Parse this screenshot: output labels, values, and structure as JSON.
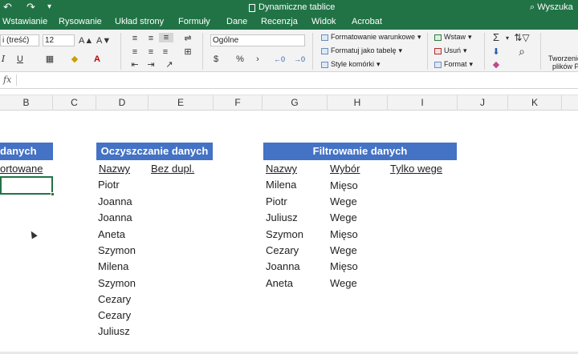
{
  "title_bar": {
    "undo_icon": "undo-icon",
    "redo_icon": "redo-icon",
    "customize_icon": "customize-qat-icon",
    "document_title": "Dynamiczne tablice",
    "search_label": "Wyszuka"
  },
  "menu": {
    "items": [
      "Wstawianie",
      "Rysowanie",
      "Układ strony",
      "Formuły",
      "Dane",
      "Recenzja",
      "Widok",
      "Acrobat"
    ]
  },
  "ribbon": {
    "font_name": "i (treść)",
    "font_size": "12",
    "grow_font": "A▲",
    "shrink_font": "A▼",
    "italic": "I",
    "underline": "U",
    "number_format": "Ogólne",
    "currency": "$",
    "percent": "%",
    "comma": "›",
    "conditional_formatting": "Formatowanie warunkowe",
    "format_as_table": "Formatuj jako tabelę",
    "cell_styles": "Style komórki",
    "insert": "Wstaw",
    "delete": "Usuń",
    "format": "Format",
    "sum": "Σ",
    "create_pdf_line1": "Tworzenie",
    "create_pdf_line2": "plików P"
  },
  "formula_bar": {
    "fx": "fx"
  },
  "columns": [
    "B",
    "C",
    "D",
    "E",
    "F",
    "G",
    "H",
    "I",
    "J",
    "K"
  ],
  "sheet": {
    "left_header": "danych",
    "left_subheader": "ortowane",
    "cleaning": {
      "header": "Oczyszczanie danych",
      "col_names": "Nazwy",
      "col_unique": "Bez dupl.",
      "names": [
        "Piotr",
        "Joanna",
        "Joanna",
        "Aneta",
        "Szymon",
        "Milena",
        "Szymon",
        "Cezary",
        "Cezary",
        "Juliusz"
      ]
    },
    "filtering": {
      "header": "Filtrowanie danych",
      "col_names": "Nazwy",
      "col_choice": "Wybór",
      "col_vege": "Tylko wege",
      "rows": [
        {
          "name": "Milena",
          "choice": "Mięso"
        },
        {
          "name": "Piotr",
          "choice": "Wege"
        },
        {
          "name": "Juliusz",
          "choice": "Wege"
        },
        {
          "name": "Szymon",
          "choice": "Mięso"
        },
        {
          "name": "Cezary",
          "choice": "Wege"
        },
        {
          "name": "Joanna",
          "choice": "Mięso"
        },
        {
          "name": "Aneta",
          "choice": "Wege"
        }
      ]
    }
  },
  "colors": {
    "excel_green": "#217346",
    "header_blue": "#4472c4"
  }
}
